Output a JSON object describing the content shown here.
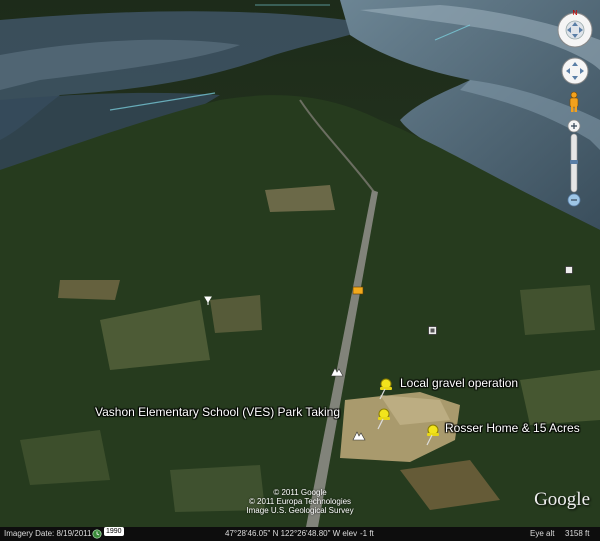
{
  "placemarks": [
    {
      "label": "Local gravel operation"
    },
    {
      "label": "Vashon Elementary School (VES) Park Taking"
    },
    {
      "label": "Rosser Home & 15 Acres"
    }
  ],
  "copyright": {
    "line1": "© 2011 Google",
    "line2": "© 2011 Europa Technologies",
    "line3": "Image U.S. Geological Survey"
  },
  "logo": "Google",
  "status": {
    "imagery_date": "Imagery Date: 8/19/2011",
    "year": "1990",
    "coordinates": "47°28'46.05\" N 122°26'48.80\" W elev",
    "elevation": "-1 ft",
    "eye_alt_label": "Eye alt",
    "eye_alt_value": "3158 ft"
  },
  "colors": {
    "water": "#4a5f6d",
    "forest": "#24381d",
    "field": "#8a7e55",
    "pin": "#f2e41c",
    "control_bg": "#f5f5f5"
  },
  "icons": [
    "look-joystick-icon",
    "move-joystick-icon",
    "street-view-pegman-icon",
    "zoom-slider-icon",
    "yellow-pushpin-icon"
  ]
}
